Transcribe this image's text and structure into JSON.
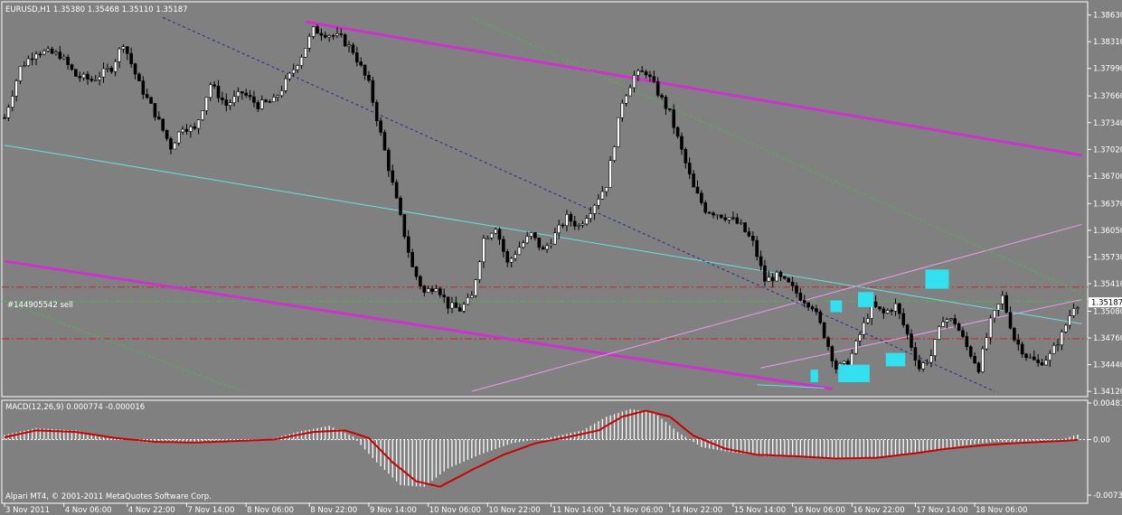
{
  "header": {
    "symbol_info": "EURUSD,H1  1.35380 1.35468 1.35110 1.35187",
    "macd_label": "MACD(12,26,9) 0.000774 -0.000016",
    "order_label": "#144905542 sell",
    "footer": "Alpari MT4, © 2001-2011 MetaQuotes Software Corp."
  },
  "price_axis": {
    "labels": [
      "1.38630",
      "1.38310",
      "1.37990",
      "1.37660",
      "1.37340",
      "1.37020",
      "1.36700",
      "1.36370",
      "1.36050",
      "1.35730",
      "1.35410",
      "1.35080",
      "1.34760",
      "1.34440",
      "1.34120"
    ],
    "current_price": "1.35187"
  },
  "macd_axis": {
    "labels": [
      "0.00481",
      "0.00",
      "-0.00731"
    ]
  },
  "time_axis": {
    "labels": [
      "3 Nov 2011",
      "4 Nov 06:00",
      "4 Nov 22:00",
      "7 Nov 14:00",
      "8 Nov 06:00",
      "8 Nov 22:00",
      "9 Nov 14:00",
      "10 Nov 06:00",
      "10 Nov 22:00",
      "11 Nov 14:00",
      "14 Nov 06:00",
      "14 Nov 22:00",
      "15 Nov 14:00",
      "16 Nov 06:00",
      "16 Nov 22:00",
      "17 Nov 14:00",
      "18 Nov 06:00"
    ]
  },
  "colors": {
    "background": "#808080",
    "candle": "#000000",
    "bull_candle_fill": "#ffffff",
    "channel_magenta": "#cc33cc",
    "channel_light": "#ee99ee",
    "trendline_cyan": "#66e0e0",
    "dashed_blue": "#1e2a8c",
    "dotted_green": "#33cc33",
    "level_red": "#cc2222",
    "level_green": "#44bb44",
    "pattern_box": "#33e0f0",
    "macd_signal": "#cc0000",
    "macd_hist": "#ffffff"
  },
  "chart_data": {
    "type": "candlestick",
    "symbol": "EURUSD",
    "timeframe": "H1",
    "ylim": [
      1.341,
      1.3868
    ],
    "macd_ylim": [
      -0.00731,
      0.00481
    ],
    "close_path": [
      [
        0,
        1.374
      ],
      [
        4,
        1.38
      ],
      [
        8,
        1.382
      ],
      [
        14,
        1.3815
      ],
      [
        18,
        1.379
      ],
      [
        22,
        1.3785
      ],
      [
        27,
        1.38
      ],
      [
        30,
        1.383
      ],
      [
        34,
        1.378
      ],
      [
        38,
        1.3745
      ],
      [
        42,
        1.3705
      ],
      [
        45,
        1.373
      ],
      [
        48,
        1.3725
      ],
      [
        52,
        1.378
      ],
      [
        56,
        1.3755
      ],
      [
        60,
        1.377
      ],
      [
        64,
        1.3755
      ],
      [
        68,
        1.376
      ],
      [
        72,
        1.379
      ],
      [
        75,
        1.3815
      ],
      [
        78,
        1.3845
      ],
      [
        82,
        1.384
      ],
      [
        85,
        1.3835
      ],
      [
        88,
        1.382
      ],
      [
        92,
        1.378
      ],
      [
        96,
        1.37
      ],
      [
        100,
        1.362
      ],
      [
        103,
        1.356
      ],
      [
        106,
        1.353
      ],
      [
        109,
        1.354
      ],
      [
        112,
        1.3515
      ],
      [
        115,
        1.351
      ],
      [
        118,
        1.3525
      ],
      [
        121,
        1.3595
      ],
      [
        124,
        1.361
      ],
      [
        127,
        1.3565
      ],
      [
        130,
        1.3585
      ],
      [
        133,
        1.36
      ],
      [
        136,
        1.358
      ],
      [
        139,
        1.36
      ],
      [
        142,
        1.362
      ],
      [
        145,
        1.361
      ],
      [
        148,
        1.363
      ],
      [
        152,
        1.366
      ],
      [
        156,
        1.376
      ],
      [
        159,
        1.379
      ],
      [
        162,
        1.3795
      ],
      [
        165,
        1.377
      ],
      [
        168,
        1.3745
      ],
      [
        171,
        1.37
      ],
      [
        174,
        1.3655
      ],
      [
        177,
        1.363
      ],
      [
        180,
        1.3625
      ],
      [
        183,
        1.362
      ],
      [
        186,
        1.361
      ],
      [
        189,
        1.359
      ],
      [
        192,
        1.3545
      ],
      [
        195,
        1.355
      ],
      [
        198,
        1.354
      ],
      [
        201,
        1.3525
      ],
      [
        204,
        1.3515
      ],
      [
        207,
        1.348
      ],
      [
        210,
        1.344
      ],
      [
        213,
        1.3445
      ],
      [
        216,
        1.348
      ],
      [
        219,
        1.3515
      ],
      [
        222,
        1.3505
      ],
      [
        225,
        1.3515
      ],
      [
        228,
        1.348
      ],
      [
        231,
        1.344
      ],
      [
        234,
        1.3455
      ],
      [
        237,
        1.35
      ],
      [
        240,
        1.3495
      ],
      [
        243,
        1.3465
      ],
      [
        246,
        1.344
      ],
      [
        249,
        1.3495
      ],
      [
        252,
        1.3525
      ],
      [
        255,
        1.3475
      ],
      [
        258,
        1.3455
      ],
      [
        261,
        1.3445
      ],
      [
        264,
        1.3455
      ],
      [
        267,
        1.348
      ],
      [
        270,
        1.3515
      ],
      [
        272,
        1.3519
      ]
    ],
    "macd_hist_path": [
      [
        0,
        0.0006
      ],
      [
        8,
        0.0015
      ],
      [
        18,
        0.0012
      ],
      [
        26,
        0.0003
      ],
      [
        36,
        -0.0004
      ],
      [
        46,
        -0.0005
      ],
      [
        56,
        -0.0002
      ],
      [
        66,
        -0.0001
      ],
      [
        74,
        0.001
      ],
      [
        82,
        0.0018
      ],
      [
        88,
        0.0004
      ],
      [
        94,
        -0.003
      ],
      [
        100,
        -0.006
      ],
      [
        106,
        -0.0062
      ],
      [
        112,
        -0.0038
      ],
      [
        120,
        -0.002
      ],
      [
        128,
        -0.0005
      ],
      [
        138,
        0.0003
      ],
      [
        146,
        0.0012
      ],
      [
        152,
        0.003
      ],
      [
        158,
        0.004
      ],
      [
        164,
        0.0036
      ],
      [
        170,
        0.001
      ],
      [
        176,
        -0.001
      ],
      [
        184,
        -0.0017
      ],
      [
        192,
        -0.0022
      ],
      [
        200,
        -0.0023
      ],
      [
        210,
        -0.0026
      ],
      [
        218,
        -0.0025
      ],
      [
        226,
        -0.002
      ],
      [
        234,
        -0.0015
      ],
      [
        242,
        -0.0008
      ],
      [
        250,
        -0.0003
      ],
      [
        258,
        -0.0004
      ],
      [
        266,
        -0.0001
      ],
      [
        272,
        0.0008
      ]
    ],
    "macd_signal_path": [
      [
        0,
        0.0003
      ],
      [
        8,
        0.0012
      ],
      [
        18,
        0.001
      ],
      [
        28,
        0.0002
      ],
      [
        38,
        -0.0003
      ],
      [
        48,
        -0.0004
      ],
      [
        58,
        -0.0002
      ],
      [
        68,
        0.0
      ],
      [
        78,
        0.001
      ],
      [
        86,
        0.0012
      ],
      [
        92,
        0.0002
      ],
      [
        98,
        -0.003
      ],
      [
        104,
        -0.0055
      ],
      [
        110,
        -0.0062
      ],
      [
        118,
        -0.004
      ],
      [
        126,
        -0.002
      ],
      [
        134,
        -0.0005
      ],
      [
        142,
        0.0003
      ],
      [
        150,
        0.0012
      ],
      [
        156,
        0.003
      ],
      [
        162,
        0.0038
      ],
      [
        168,
        0.003
      ],
      [
        174,
        0.0005
      ],
      [
        182,
        -0.0012
      ],
      [
        190,
        -0.002
      ],
      [
        200,
        -0.0022
      ],
      [
        210,
        -0.0025
      ],
      [
        220,
        -0.0024
      ],
      [
        230,
        -0.0018
      ],
      [
        238,
        -0.0012
      ],
      [
        246,
        -0.0008
      ],
      [
        254,
        -0.0005
      ],
      [
        262,
        -0.0003
      ],
      [
        270,
        -0.0001
      ],
      [
        272,
        0.0
      ]
    ],
    "order_line_price": 1.352,
    "level_lines": [
      1.3537,
      1.3475
    ],
    "channels": [
      {
        "style": "magenta_thick",
        "points": [
          [
            76,
            1.3855
          ],
          [
            272,
            1.3695
          ]
        ]
      },
      {
        "style": "magenta_thick",
        "points": [
          [
            0,
            1.3568
          ],
          [
            209,
            1.3415
          ]
        ]
      },
      {
        "style": "light_pink",
        "points": [
          [
            118,
            1.3412
          ],
          [
            272,
            1.3612
          ]
        ]
      },
      {
        "style": "light_pink",
        "points": [
          [
            191,
            1.344
          ],
          [
            272,
            1.3522
          ]
        ]
      },
      {
        "style": "cyan",
        "points": [
          [
            0,
            1.3707
          ],
          [
            272,
            1.3493
          ]
        ]
      },
      {
        "style": "cyan",
        "points": [
          [
            190,
            1.342
          ],
          [
            207,
            1.3416
          ]
        ]
      },
      {
        "style": "dashed_blue",
        "points": [
          [
            40,
            1.386
          ],
          [
            250,
            1.3412
          ]
        ]
      },
      {
        "style": "dotted_green",
        "points": [
          [
            118,
            1.386
          ],
          [
            272,
            1.353
          ]
        ]
      },
      {
        "style": "dotted_green",
        "points": [
          [
            0,
            1.352
          ],
          [
            60,
            1.3412
          ]
        ]
      }
    ],
    "boxes": [
      {
        "c": [
          204,
          205
        ],
        "p": [
          1.3423,
          1.3438
        ]
      },
      {
        "c": [
          209,
          211
        ],
        "p": [
          1.3507,
          1.3521
        ]
      },
      {
        "c": [
          211,
          218
        ],
        "p": [
          1.3423,
          1.3444
        ]
      },
      {
        "c": [
          216,
          219
        ],
        "p": [
          1.3513,
          1.3531
        ]
      },
      {
        "c": [
          223,
          227
        ],
        "p": [
          1.3442,
          1.3458
        ]
      },
      {
        "c": [
          233,
          238
        ],
        "p": [
          1.3535,
          1.3558
        ]
      }
    ],
    "time_label_candles": [
      0,
      15,
      31,
      46,
      61,
      77,
      92,
      107,
      122,
      138,
      153,
      168,
      184,
      199,
      214,
      230,
      245
    ],
    "n_candles": 272
  }
}
